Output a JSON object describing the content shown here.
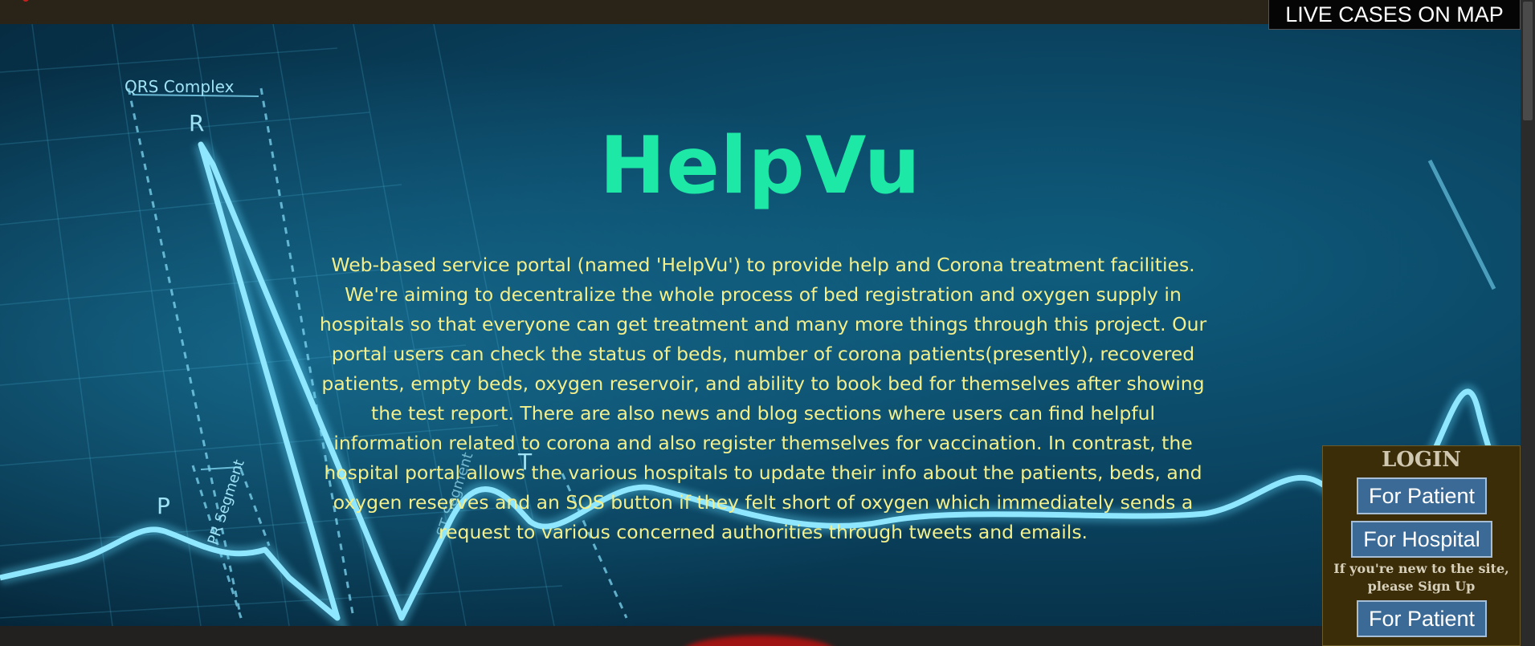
{
  "header": {
    "live_cases_label": "LIVE CASES ON MAP"
  },
  "hero": {
    "title": "HelpVu",
    "description": "Web-based service portal (named 'HelpVu') to provide help and Corona treatment facilities. We're aiming to decentralize the whole process of bed registration and oxygen supply in hospitals so that everyone can get treatment and many more things through this project. Our portal users can check the status of beds, number of corona patients(presently), recovered patients, empty beds, oxygen reservoir, and ability to book bed for themselves after showing the test report. There are also news and blog sections where users can find helpful information related to corona and also register themselves for vaccination. In contrast, the hospital portal allows the various hospitals to update their info about the patients, beds, and oxygen reserves and an SOS button if they felt short of oxygen which immediately sends a request to various concerned authorities through tweets and emails.",
    "background_labels": {
      "qrs": "QRS Complex",
      "r": "R",
      "p": "P",
      "t": "T",
      "pr_segment": "PR Segment",
      "st_segment": "ST Segment"
    }
  },
  "login": {
    "title": "LOGIN",
    "patient_login_label": "For Patient",
    "hospital_login_label": "For Hospital",
    "signup_note": "If you're new to the site, please Sign Up",
    "patient_signup_label": "For Patient"
  },
  "colors": {
    "title": "#1de8a6",
    "description": "#f3ef8a",
    "ecg_line": "#7fe3ff",
    "button": "#3a6a95",
    "login_panel": "#3b2d08"
  }
}
